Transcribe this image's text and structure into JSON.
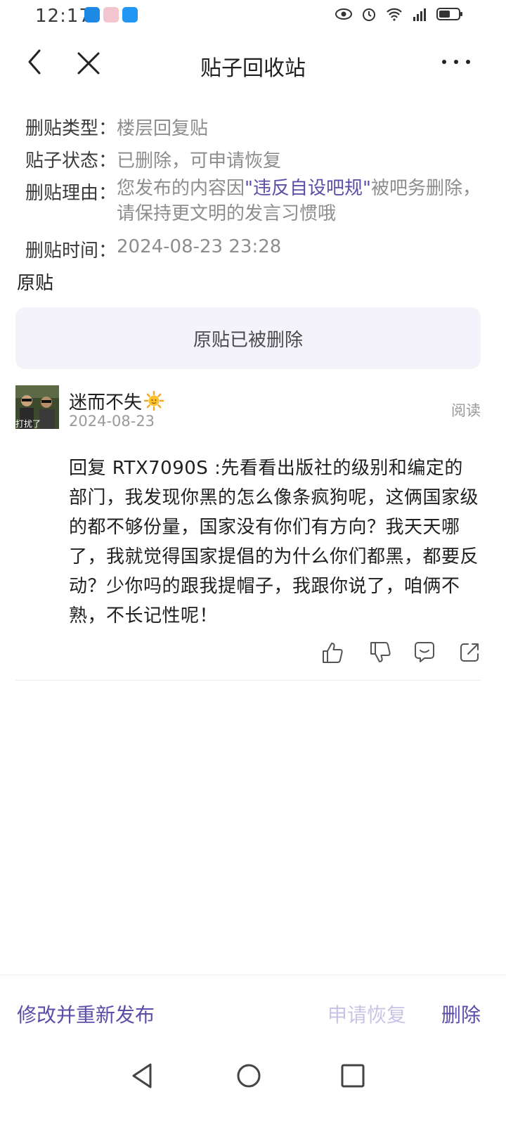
{
  "status_bar": {
    "time": "12:17"
  },
  "nav": {
    "title": "贴子回收站"
  },
  "meta": {
    "type_label": "删贴类型：",
    "type_value": "楼层回复贴",
    "state_label": "贴子状态：",
    "state_value": "已删除，可申请恢复",
    "reason_label": "删贴理由：",
    "reason_prefix": "您发布的内容因",
    "reason_highlight": "\"违反自设吧规\"",
    "reason_suffix": "被吧务删除，请保持更文明的发言习惯哦",
    "time_label": "删贴时间：",
    "time_value": "2024-08-23 23:28"
  },
  "original": {
    "section_title": "原贴",
    "deleted_notice": "原贴已被删除"
  },
  "reply": {
    "avatar_caption": "打扰了",
    "username": "迷而不失",
    "date": "2024-08-23",
    "read_label": "阅读",
    "body": " 回复  RTX7090S :先看看出版社的级别和编定的部门，我发现你黑的怎么像条疯狗呢，这俩国家级的都不够份量，国家没有你们有方向？我天天哪了，我就觉得国家提倡的为什么你们都黑，都要反动？少你吗的跟我提帽子，我跟你说了，咱俩不熟，不长记性呢！"
  },
  "bottom_bar": {
    "edit_label": "修改并重新发布",
    "restore_label": "申请恢复",
    "delete_label": "删除"
  },
  "colors": {
    "accent": "#5a4ea8",
    "accent_disabled": "#c8c4e6",
    "notice_bg": "#f4f3fb"
  }
}
